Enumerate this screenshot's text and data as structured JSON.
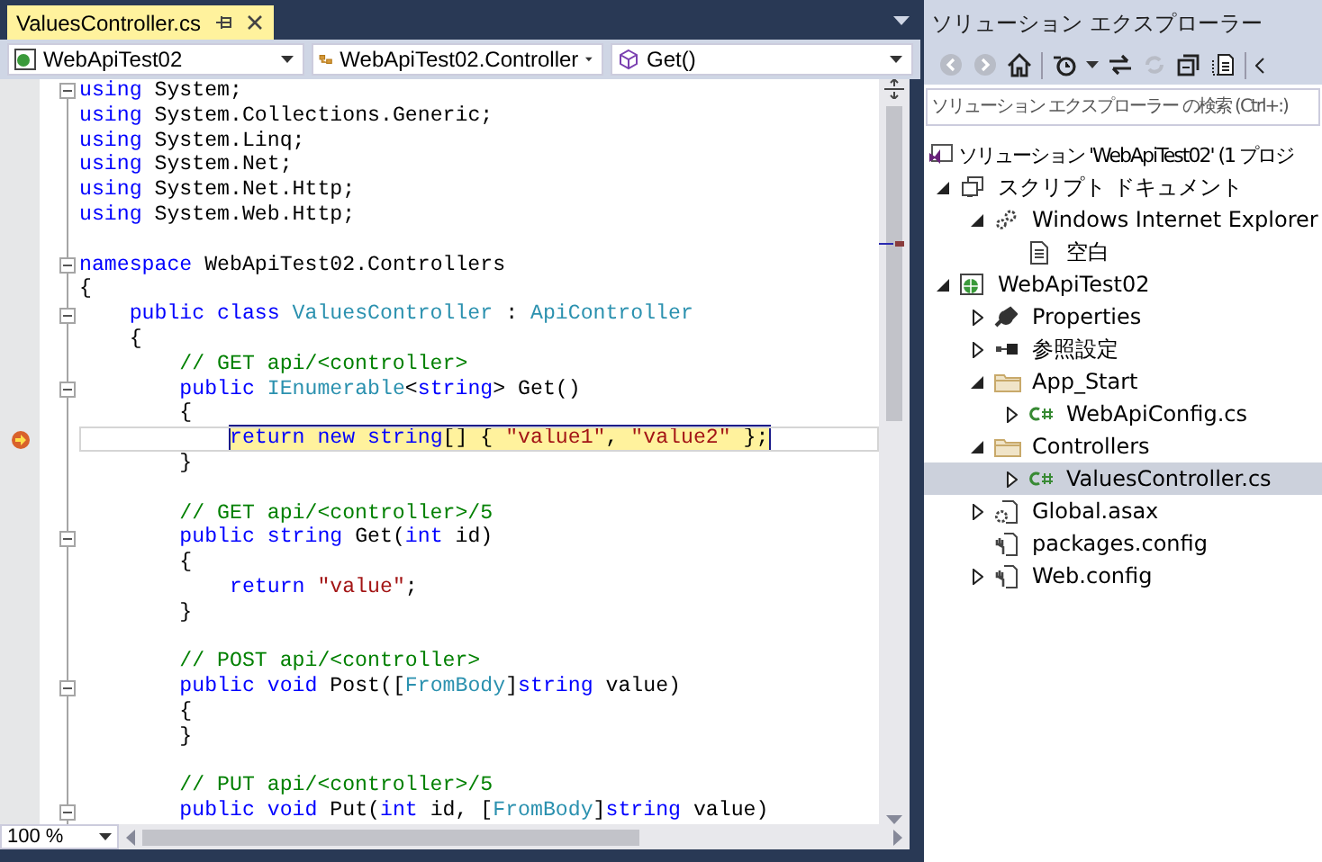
{
  "document_tab": {
    "title": "ValuesController.cs",
    "selected": true
  },
  "nav_bar": {
    "project": "WebApiTest02",
    "type": "WebApiTest02.Controller",
    "member": "Get()"
  },
  "code_lines": [
    {
      "tokens": [
        {
          "kind": "keyword",
          "text": "using"
        },
        {
          "kind": "plain",
          "text": " System;"
        }
      ],
      "collapsible": true,
      "current": false
    },
    {
      "tokens": [
        {
          "kind": "keyword",
          "text": "using"
        },
        {
          "kind": "plain",
          "text": " System.Collections.Generic;"
        }
      ],
      "collapsible": false,
      "current": false
    },
    {
      "tokens": [
        {
          "kind": "keyword",
          "text": "using"
        },
        {
          "kind": "plain",
          "text": " System.Linq;"
        }
      ],
      "collapsible": false,
      "current": false
    },
    {
      "tokens": [
        {
          "kind": "keyword",
          "text": "using"
        },
        {
          "kind": "plain",
          "text": " System.Net;"
        }
      ],
      "collapsible": false,
      "current": false
    },
    {
      "tokens": [
        {
          "kind": "keyword",
          "text": "using"
        },
        {
          "kind": "plain",
          "text": " System.Net.Http;"
        }
      ],
      "collapsible": false,
      "current": false
    },
    {
      "tokens": [
        {
          "kind": "keyword",
          "text": "using"
        },
        {
          "kind": "plain",
          "text": " System.Web.Http;"
        }
      ],
      "collapsible": false,
      "current": false
    },
    {
      "collapsible": false,
      "current": false
    },
    {
      "tokens": [
        {
          "kind": "keyword",
          "text": "namespace"
        },
        {
          "kind": "plain",
          "text": " WebApiTest02.Controllers"
        }
      ],
      "collapsible": true,
      "current": false
    },
    {
      "tokens": [
        {
          "kind": "plain",
          "text": "{"
        }
      ],
      "collapsible": false,
      "current": false
    },
    {
      "tokens": [
        {
          "kind": "keyword",
          "text": "    public class "
        },
        {
          "kind": "type",
          "text": "ValuesController"
        },
        {
          "kind": "plain",
          "text": " : "
        },
        {
          "kind": "type",
          "text": "ApiController"
        }
      ],
      "collapsible": true,
      "current": false
    },
    {
      "tokens": [
        {
          "kind": "plain",
          "text": "    {"
        }
      ],
      "collapsible": false,
      "current": false
    },
    {
      "tokens": [
        {
          "kind": "comment",
          "text": "        // GET api/<controller>"
        }
      ],
      "collapsible": false,
      "current": false
    },
    {
      "tokens": [
        {
          "kind": "keyword",
          "text": "        public "
        },
        {
          "kind": "type",
          "text": "IEnumerable"
        },
        {
          "kind": "plain",
          "text": "<"
        },
        {
          "kind": "keyword",
          "text": "string"
        },
        {
          "kind": "plain",
          "text": "> Get()"
        }
      ],
      "collapsible": true,
      "current": false
    },
    {
      "tokens": [
        {
          "kind": "plain",
          "text": "        {"
        }
      ],
      "collapsible": false,
      "current": false
    },
    {
      "tokens": [
        {
          "kind": "keyword",
          "text": "            return new string"
        },
        {
          "kind": "plain",
          "text": "[] { "
        },
        {
          "kind": "string",
          "text": "\"value1\""
        },
        {
          "kind": "plain",
          "text": ", "
        },
        {
          "kind": "string",
          "text": "\"value2\""
        },
        {
          "kind": "plain",
          "text": " };"
        }
      ],
      "collapsible": false,
      "current": true
    },
    {
      "tokens": [
        {
          "kind": "plain",
          "text": "        }"
        }
      ],
      "collapsible": false,
      "current": false
    },
    {
      "collapsible": false,
      "current": false
    },
    {
      "tokens": [
        {
          "kind": "comment",
          "text": "        // GET api/<controller>/5"
        }
      ],
      "collapsible": false,
      "current": false
    },
    {
      "tokens": [
        {
          "kind": "keyword",
          "text": "        public string"
        },
        {
          "kind": "plain",
          "text": " Get("
        },
        {
          "kind": "keyword",
          "text": "int"
        },
        {
          "kind": "plain",
          "text": " id)"
        }
      ],
      "collapsible": true,
      "current": false
    },
    {
      "tokens": [
        {
          "kind": "plain",
          "text": "        {"
        }
      ],
      "collapsible": false,
      "current": false
    },
    {
      "tokens": [
        {
          "kind": "keyword",
          "text": "            return "
        },
        {
          "kind": "string",
          "text": "\"value\""
        },
        {
          "kind": "plain",
          "text": ";"
        }
      ],
      "collapsible": false,
      "current": false
    },
    {
      "tokens": [
        {
          "kind": "plain",
          "text": "        }"
        }
      ],
      "collapsible": false,
      "current": false
    },
    {
      "collapsible": false,
      "current": false
    },
    {
      "tokens": [
        {
          "kind": "comment",
          "text": "        // POST api/<controller>"
        }
      ],
      "collapsible": false,
      "current": false
    },
    {
      "tokens": [
        {
          "kind": "keyword",
          "text": "        public void"
        },
        {
          "kind": "plain",
          "text": " Post(["
        },
        {
          "kind": "type",
          "text": "FromBody"
        },
        {
          "kind": "plain",
          "text": "]"
        },
        {
          "kind": "keyword",
          "text": "string"
        },
        {
          "kind": "plain",
          "text": " value)"
        }
      ],
      "collapsible": true,
      "current": false
    },
    {
      "tokens": [
        {
          "kind": "plain",
          "text": "        {"
        }
      ],
      "collapsible": false,
      "current": false
    },
    {
      "tokens": [
        {
          "kind": "plain",
          "text": "        }"
        }
      ],
      "collapsible": false,
      "current": false
    },
    {
      "collapsible": false,
      "current": false
    },
    {
      "tokens": [
        {
          "kind": "comment",
          "text": "        // PUT api/<controller>/5"
        }
      ],
      "collapsible": false,
      "current": false
    },
    {
      "tokens": [
        {
          "kind": "keyword",
          "text": "        public void"
        },
        {
          "kind": "plain",
          "text": " Put("
        },
        {
          "kind": "keyword",
          "text": "int"
        },
        {
          "kind": "plain",
          "text": " id, ["
        },
        {
          "kind": "type",
          "text": "FromBody"
        },
        {
          "kind": "plain",
          "text": "]"
        },
        {
          "kind": "keyword",
          "text": "string"
        },
        {
          "kind": "plain",
          "text": " value)"
        }
      ],
      "collapsible": true,
      "current": false
    }
  ],
  "zoom": "100 %",
  "solution_explorer": {
    "title": "ソリューション エクスプローラー",
    "search": {
      "placeholder": "ソリューション エクスプローラー の検索 (Ctrl+:)"
    },
    "tree": [
      {
        "kind": "solution",
        "label": "ソリューション 'WebApiTest02' (1 プロジ",
        "selected": false
      },
      {
        "kind": "script",
        "label": "スクリプト ドキュメント",
        "expanded": true,
        "selected": false,
        "children": [
          {
            "kind": "browser",
            "label": "Windows Internet Explorer",
            "expanded": true,
            "selected": false,
            "children": [
              {
                "kind": "page",
                "label": "空白",
                "selected": false
              }
            ]
          }
        ]
      },
      {
        "kind": "project",
        "label": "WebApiTest02",
        "expanded": true,
        "selected": false,
        "children": [
          {
            "kind": "properties",
            "label": "Properties",
            "expanded": false,
            "selected": false
          },
          {
            "kind": "references",
            "label": "参照設定",
            "expanded": false,
            "selected": false
          },
          {
            "kind": "folder",
            "label": "App_Start",
            "expanded": true,
            "selected": false,
            "children": [
              {
                "kind": "csharp",
                "label": "WebApiConfig.cs",
                "expanded": false,
                "selected": false
              }
            ]
          },
          {
            "kind": "folder",
            "label": "Controllers",
            "expanded": true,
            "selected": false,
            "children": [
              {
                "kind": "csharp",
                "label": "ValuesController.cs",
                "expanded": false,
                "selected": true
              }
            ]
          },
          {
            "kind": "asax",
            "label": "Global.asax",
            "expanded": false,
            "selected": false
          },
          {
            "kind": "config",
            "label": "packages.config",
            "selected": false
          },
          {
            "kind": "config",
            "label": "Web.config",
            "expanded": false,
            "selected": false
          }
        ]
      }
    ]
  }
}
